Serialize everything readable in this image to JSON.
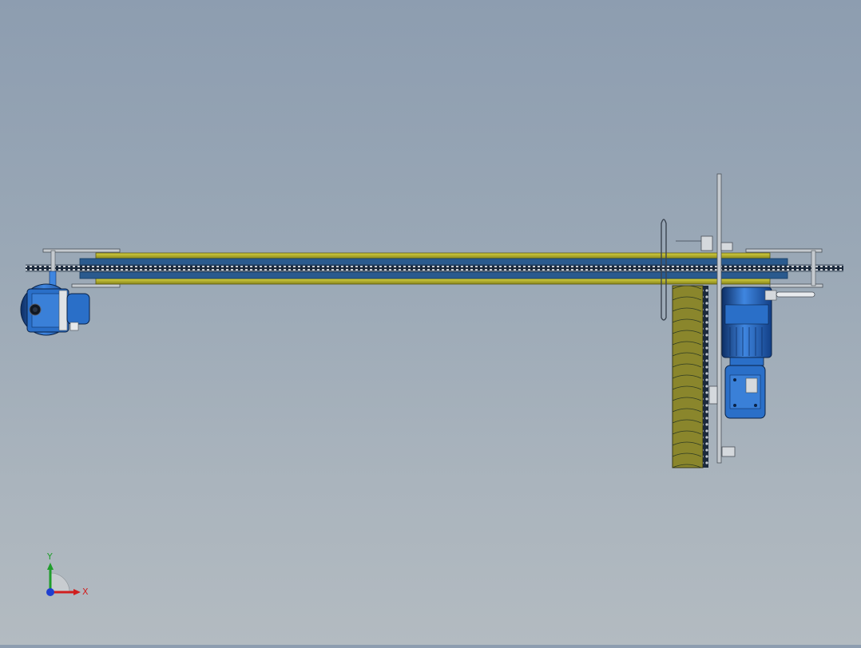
{
  "viewport": {
    "background_top": "#8d9db0",
    "background_bottom": "#b3bbc1"
  },
  "colors": {
    "rail_yellow": "#b8b42a",
    "rail_yellow_dark": "#6f6c14",
    "belt_blue": "#2a5a8e",
    "belt_dark": "#123a62",
    "chain": "#1c2a3c",
    "frame_grey": "#b9bfc4",
    "frame_dark": "#4a5058",
    "motor_blue": "#1f5fb8",
    "motor_blue_light": "#3f86e0",
    "motor_dark": "#0e2f66",
    "olive_panel": "#7d7a2a"
  },
  "triad": {
    "x_label": "X",
    "y_label": "Y",
    "x_color": "#d01f1f",
    "y_color": "#1f9d2b",
    "z_color": "#1f3fd0"
  },
  "components": {
    "main_conveyor": "main-conveyor",
    "left_motor": "left-gearmotor",
    "right_motor": "right-gearmotor",
    "side_conveyor": "side-conveyor"
  }
}
